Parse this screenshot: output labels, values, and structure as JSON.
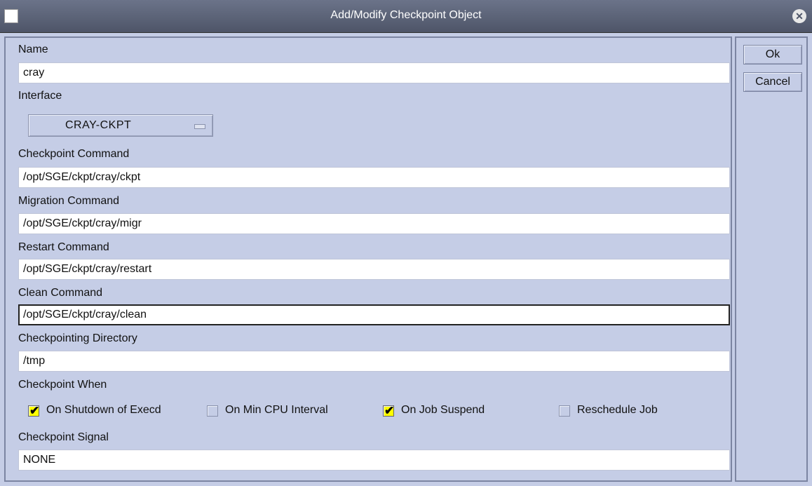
{
  "window": {
    "title": "Add/Modify Checkpoint Object",
    "close_icon": "close-icon"
  },
  "buttons": {
    "ok": "Ok",
    "cancel": "Cancel"
  },
  "form": {
    "name_label": "Name",
    "name_value": "cray",
    "interface_label": "Interface",
    "interface_value": "CRAY-CKPT",
    "ckpt_cmd_label": "Checkpoint Command",
    "ckpt_cmd_value": "/opt/SGE/ckpt/cray/ckpt",
    "migr_cmd_label": "Migration Command",
    "migr_cmd_value": "/opt/SGE/ckpt/cray/migr",
    "restart_cmd_label": "Restart Command",
    "restart_cmd_value": "/opt/SGE/ckpt/cray/restart",
    "clean_cmd_label": "Clean Command",
    "clean_cmd_value": "/opt/SGE/ckpt/cray/clean",
    "ckpt_dir_label": "Checkpointing Directory",
    "ckpt_dir_value": "/tmp",
    "when_label": "Checkpoint When",
    "when_options": [
      {
        "label": "On Shutdown of Execd",
        "checked": true
      },
      {
        "label": "On Min CPU Interval",
        "checked": false
      },
      {
        "label": "On Job Suspend",
        "checked": true
      },
      {
        "label": "Reschedule Job",
        "checked": false
      }
    ],
    "signal_label": "Checkpoint Signal",
    "signal_value": "NONE"
  },
  "colors": {
    "background": "#c5cde6",
    "titlebar": "#4e5568",
    "checked": "#ffff00"
  }
}
